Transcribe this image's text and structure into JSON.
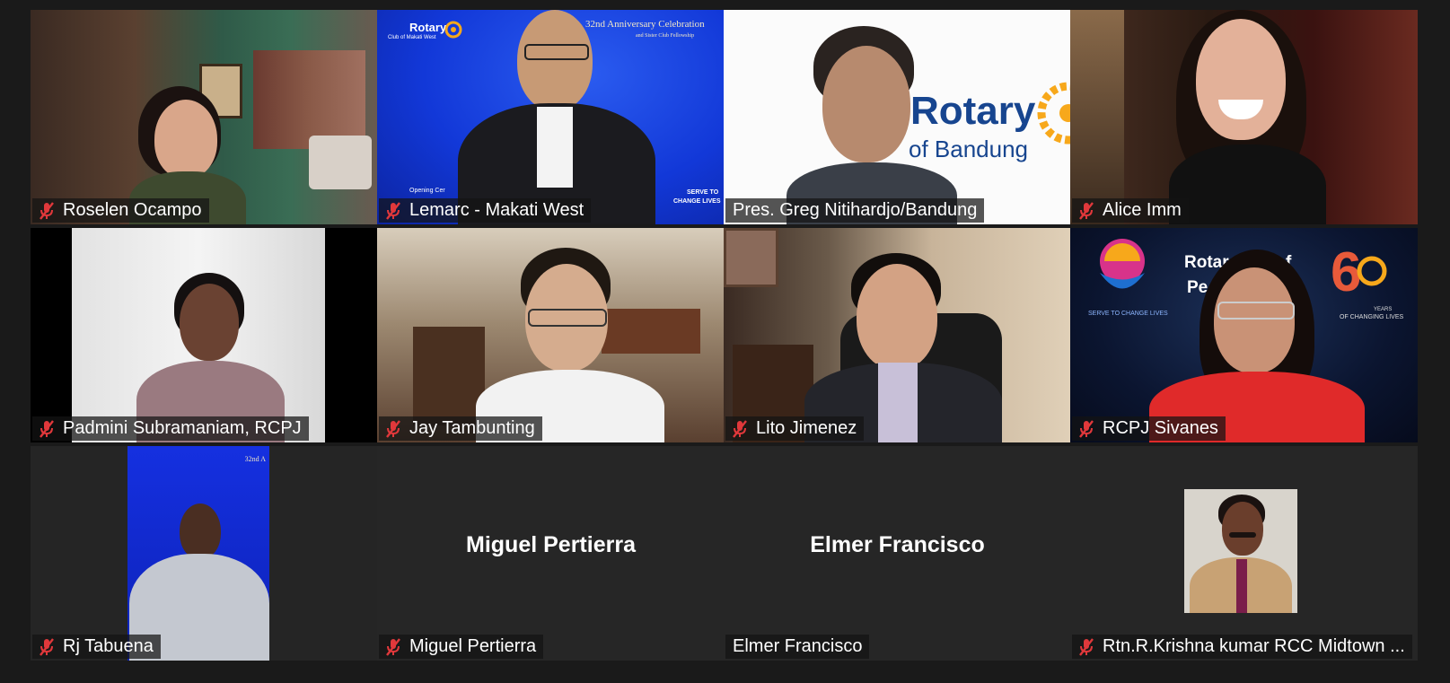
{
  "participants": [
    {
      "name": "Roselen Ocampo",
      "muted": true
    },
    {
      "name": "Lemarc - Makati West",
      "muted": true
    },
    {
      "name": "Pres. Greg Nitihardjo/Bandung",
      "muted": false
    },
    {
      "name": "Alice Imm",
      "muted": true
    },
    {
      "name": "Padmini Subramaniam, RCPJ",
      "muted": true
    },
    {
      "name": "Jay Tambunting",
      "muted": true
    },
    {
      "name": "Lito Jimenez",
      "muted": true
    },
    {
      "name": "RCPJ Sivanes",
      "muted": true
    },
    {
      "name": "Rj Tabuena",
      "muted": true
    },
    {
      "name": "Miguel Pertierra",
      "muted": true
    },
    {
      "name": "Elmer Francisco",
      "muted": false
    },
    {
      "name": "Rtn.R.Krishna kumar RCC Midtown ...",
      "muted": true
    }
  ],
  "no_video": {
    "miguel": "Miguel Pertierra",
    "elmer": "Elmer Francisco"
  },
  "backgrounds": {
    "lemarc_brand": "Rotary",
    "lemarc_club": "Club of Makati West",
    "lemarc_title": "32nd Anniversary Celebration",
    "lemarc_subtitle": "and Sister Club Fellowship",
    "lemarc_footer_left": "Opening Cer",
    "lemarc_footer_right1": "SERVE TO",
    "lemarc_footer_right2": "CHANGE LIVES",
    "greg_brand": "Rotary",
    "greg_club": "of Bandung",
    "sivanes_brand": "Rotar",
    "sivanes_brand2": "f",
    "sivanes_brand3": "Pe",
    "sivanes_left_caption": "SERVE TO CHANGE LIVES",
    "sivanes_right_caption1": "YEARS",
    "sivanes_right_caption2": "OF CHANGING LIVES",
    "rj_corner": "32nd A"
  },
  "colors": {
    "muted_icon": "#e0383b",
    "rotary_blue": "#17458f",
    "rotary_gold": "#f7a81b",
    "virtual_bg_blue": "#1238d8"
  }
}
